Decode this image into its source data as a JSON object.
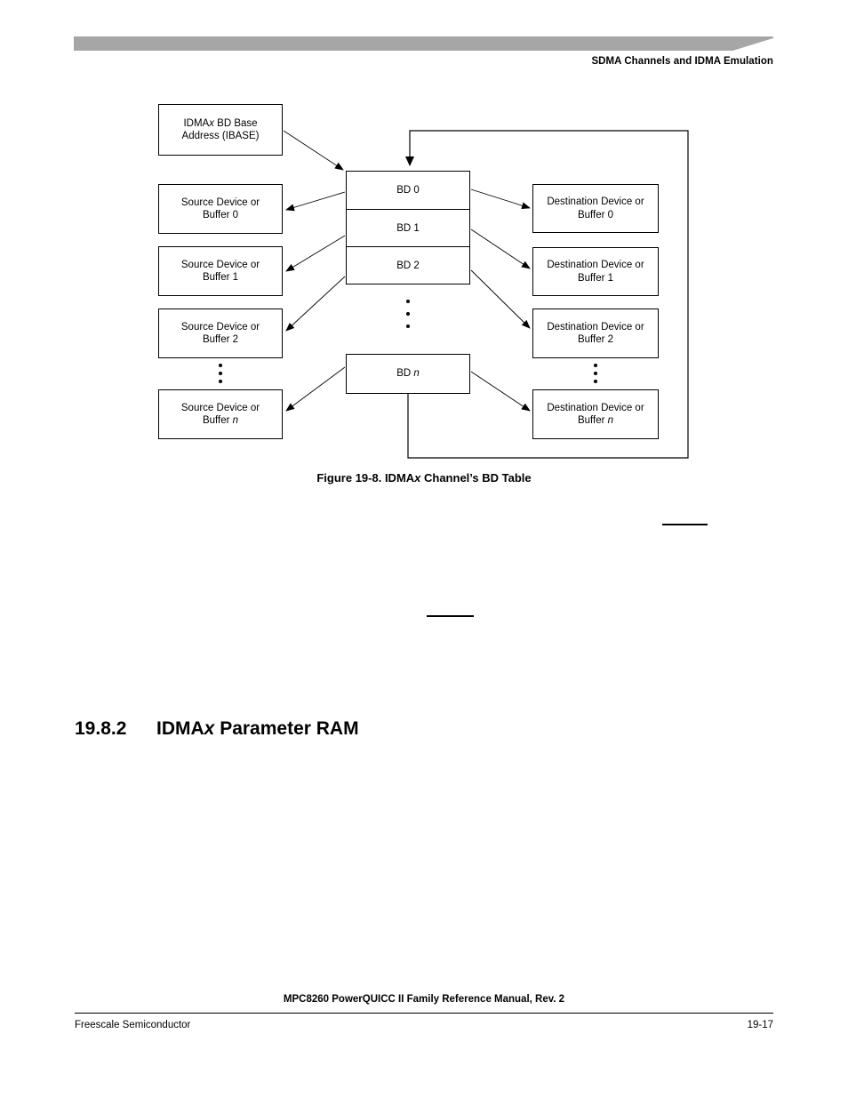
{
  "header": {
    "title": "SDMA Channels and IDMA Emulation"
  },
  "figure": {
    "caption_prefix": "Figure 19-8. IDMA",
    "caption_italic": "x",
    "caption_suffix": " Channel’s BD Table",
    "ibase_box": {
      "line1_pre": "IDMA",
      "line1_italic": "x",
      "line1_post": " BD Base",
      "line2": "Address (IBASE)"
    },
    "bd_cells": [
      {
        "label": "BD 0"
      },
      {
        "label": "BD 1"
      },
      {
        "label": "BD 2"
      }
    ],
    "bd_last": {
      "pre": "BD ",
      "italic": "n"
    },
    "source_boxes": [
      {
        "line1": "Source Device or",
        "line2_pre": "Buffer ",
        "line2_value": "0",
        "italic": false
      },
      {
        "line1": "Source Device or",
        "line2_pre": "Buffer ",
        "line2_value": "1",
        "italic": false
      },
      {
        "line1": "Source Device or",
        "line2_pre": "Buffer ",
        "line2_value": "2",
        "italic": false
      },
      {
        "line1": "Source Device or",
        "line2_pre": "Buffer ",
        "line2_value": "n",
        "italic": true
      }
    ],
    "destination_boxes": [
      {
        "line1": "Destination Device or",
        "line2_pre": "Buffer ",
        "line2_value": "0",
        "italic": false
      },
      {
        "line1": "Destination Device or",
        "line2_pre": "Buffer ",
        "line2_value": "1",
        "italic": false
      },
      {
        "line1": "Destination Device or",
        "line2_pre": "Buffer ",
        "line2_value": "2",
        "italic": false
      },
      {
        "line1": "Destination Device or",
        "line2_pre": "Buffer ",
        "line2_value": "n",
        "italic": true
      }
    ]
  },
  "section": {
    "number": "19.8.2",
    "title_pre": "IDMA",
    "title_italic": "x",
    "title_post": " Parameter RAM"
  },
  "footer": {
    "manual_title": "MPC8260 PowerQUICC II Family Reference Manual, Rev. 2",
    "company": "Freescale Semiconductor",
    "page_number": "19-17"
  },
  "colors": {
    "header_bar": "#a6a6a6",
    "ink": "#000000",
    "page": "#ffffff"
  }
}
